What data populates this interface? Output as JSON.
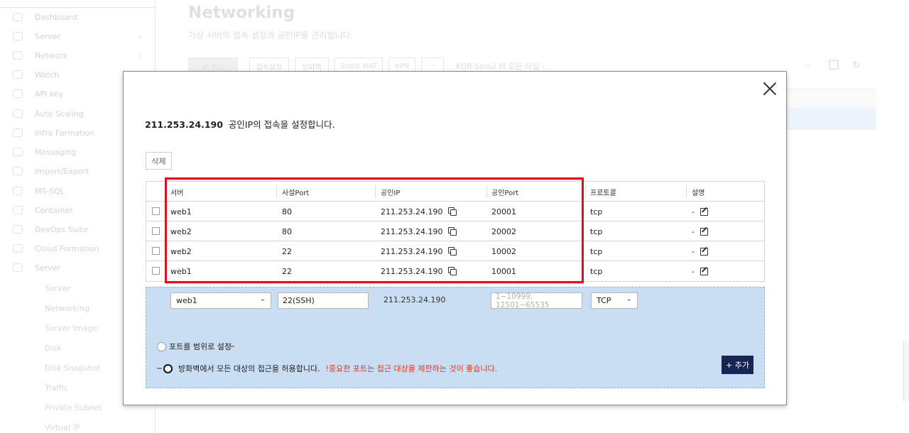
{
  "background": {
    "title": "Networking",
    "subtitle": "가상 서버의 접속 설정과 공인IP를 관리합니다.",
    "sidebar_items": [
      "Dashboard",
      "Server",
      "Network",
      "Watch",
      "API key",
      "Auto Scaling",
      "Infra Formation",
      "Messaging",
      "Import/Export",
      "MS-SQL",
      "Container",
      "DevOps Suite",
      "Cloud Formation",
      "Server"
    ],
    "sidebar_subitems": [
      "Server",
      "Networking",
      "Server Image",
      "Disk",
      "Disk Snapshot",
      "Traffic",
      "Private Subnet",
      "Virtual IP"
    ],
    "toolbar": [
      "IP 생성",
      "접속설정",
      "방화벽",
      "Static NAT",
      "VPN",
      "···"
    ],
    "region": "KOR-Seoul M   모든 타입 ›"
  },
  "modal": {
    "ip": "211.253.24.190",
    "title_suffix": "공인IP의 접속을 설정합니다.",
    "delete_label": "삭제",
    "columns": [
      "서버",
      "사설Port",
      "공인IP",
      "공인Port",
      "프로토콜",
      "설명"
    ],
    "rows": [
      {
        "server": "web1",
        "private_port": "80",
        "public_ip": "211.253.24.190",
        "public_port": "20001",
        "protocol": "tcp",
        "desc": "-"
      },
      {
        "server": "web2",
        "private_port": "80",
        "public_ip": "211.253.24.190",
        "public_port": "20002",
        "protocol": "tcp",
        "desc": "-"
      },
      {
        "server": "web2",
        "private_port": "22",
        "public_ip": "211.253.24.190",
        "public_port": "10002",
        "protocol": "tcp",
        "desc": "-"
      },
      {
        "server": "web1",
        "private_port": "22",
        "public_ip": "211.253.24.190",
        "public_port": "10001",
        "protocol": "tcp",
        "desc": "-"
      }
    ],
    "add_form": {
      "server_value": "web1",
      "private_port_value": "22(SSH)",
      "public_ip": "211.253.24.190",
      "public_port_placeholder": "1~10999, 12501~65535",
      "protocol_value": "TCP",
      "range_label": "포트를 범위로 설정",
      "allow_all_label": "방화벽에서 모든 대상의 접근을 허용합니다.",
      "warning": "!중요한 포트는 접근 대상을 제한하는 것이 좋습니다.",
      "add_label": "+ 추가"
    }
  }
}
